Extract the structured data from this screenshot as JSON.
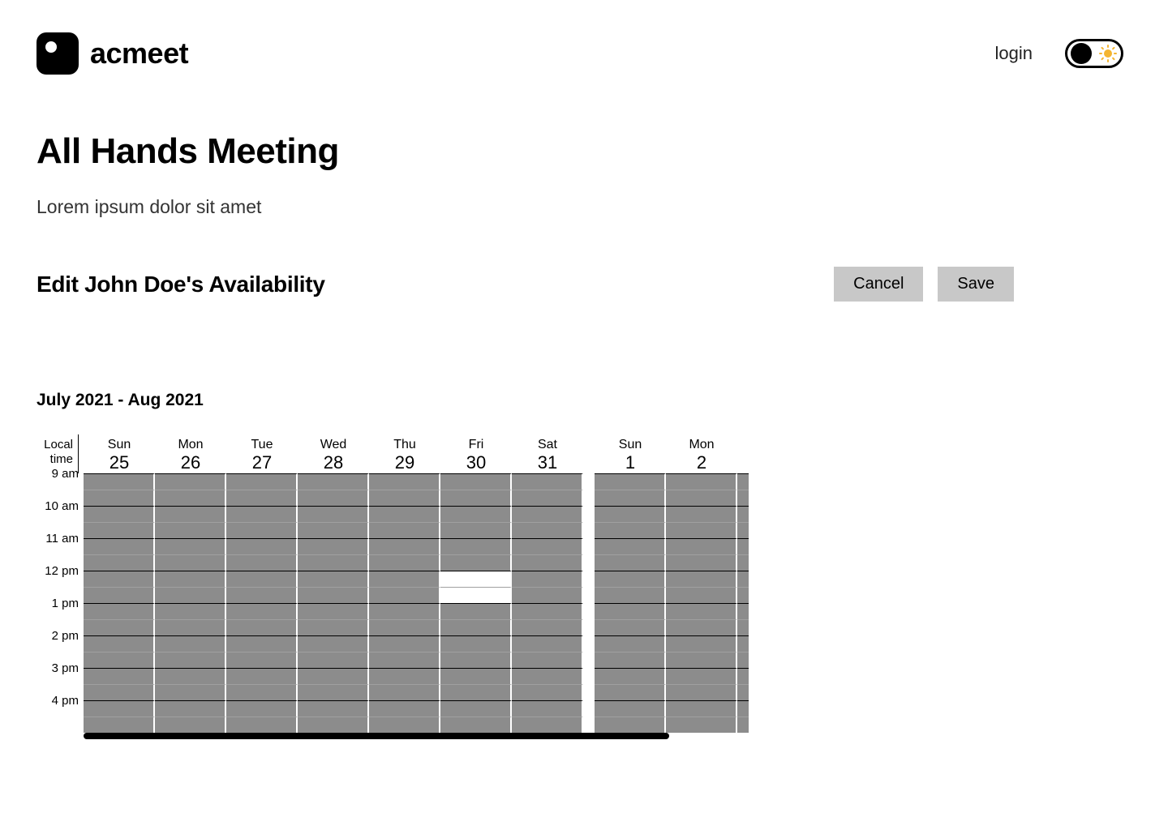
{
  "brand": {
    "name": "acmeet"
  },
  "header": {
    "login_label": "login"
  },
  "page": {
    "title": "All Hands Meeting",
    "subtitle": "Lorem ipsum dolor sit amet",
    "edit_heading": "Edit John Doe's Availability",
    "cancel_label": "Cancel",
    "save_label": "Save",
    "date_range": "July 2021 - Aug  2021",
    "timezone_label": "Local time",
    "days": [
      {
        "dow": "Sun",
        "num": "25",
        "week_break_after": false
      },
      {
        "dow": "Mon",
        "num": "26",
        "week_break_after": false
      },
      {
        "dow": "Tue",
        "num": "27",
        "week_break_after": false
      },
      {
        "dow": "Wed",
        "num": "28",
        "week_break_after": false
      },
      {
        "dow": "Thu",
        "num": "29",
        "week_break_after": false
      },
      {
        "dow": "Fri",
        "num": "30",
        "week_break_after": false
      },
      {
        "dow": "Sat",
        "num": "31",
        "week_break_after": true
      },
      {
        "dow": "Sun",
        "num": "1",
        "week_break_after": false
      },
      {
        "dow": "Mon",
        "num": "2",
        "week_break_after": false
      }
    ],
    "half_day_header": true,
    "times": [
      "9 am",
      "10 am",
      "11 am",
      "12 pm",
      "1 pm",
      "2 pm",
      "3 pm",
      "4 pm"
    ],
    "free_slots": {
      "5": {
        "6": true,
        "7": true
      }
    }
  }
}
